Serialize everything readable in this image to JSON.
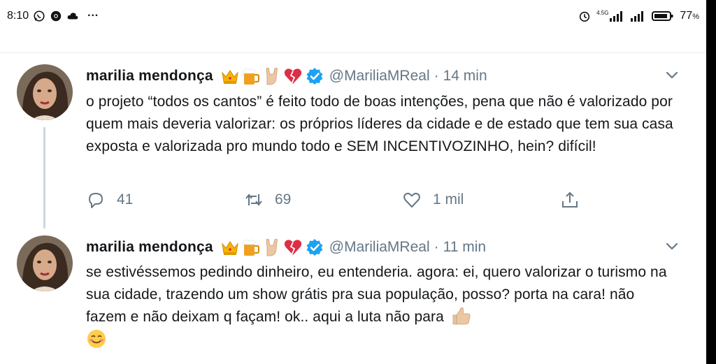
{
  "status_bar": {
    "time": "8:10",
    "dots": "···",
    "network_label": "4.5G",
    "battery": "77",
    "battery_unit": "%"
  },
  "tweets": [
    {
      "author": "marilia mendonça",
      "handle": "@MariliaMReal",
      "separator": "·",
      "time": "14 min",
      "emojis": [
        "crown-emoji",
        "beer-mug-emoji",
        "rock-hand-emoji",
        "broken-heart-emoji"
      ],
      "text": "o projeto “todos os cantos” é feito todo de boas intenções, pena que não é valorizado por quem mais deveria valorizar: os próprios líderes da cidade e de estado que tem sua casa exposta e valorizada pro mundo todo e SEM INCENTIVOZINHO, hein? difícil!",
      "replies": "41",
      "retweets": "69",
      "likes": "1 mil"
    },
    {
      "author": "marilia mendonça",
      "handle": "@MariliaMReal",
      "separator": "·",
      "time": "11 min",
      "emojis": [
        "crown-emoji",
        "beer-mug-emoji",
        "rock-hand-emoji",
        "broken-heart-emoji"
      ],
      "text": "se estivéssemos pedindo dinheiro, eu entenderia. agora: ei, quero valorizar o turismo na sua cidade, trazendo um show grátis pra sua população, posso? porta na cara! não fazem e não deixam q façam! ok.. aqui a luta não para",
      "trailing_emojis": [
        "thumbs-up-emoji",
        "smiling-face-emoji"
      ]
    }
  ],
  "colors": {
    "text": "#14171a",
    "muted": "#657786",
    "verified": "#1da1f2",
    "divider": "#e6ecf0"
  }
}
